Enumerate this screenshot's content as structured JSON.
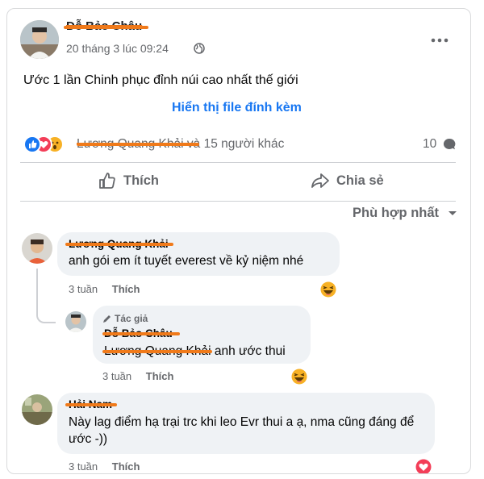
{
  "post": {
    "author_name": "Đỗ Bảo Châu",
    "timestamp": "20 tháng 3 lúc 09:24",
    "audience_icon": "globe-icon",
    "text": "Ước 1 lần Chinh phục đỉnh núi cao nhất thế giới",
    "attachment_link": "Hiển thị file đính kèm",
    "reactions": {
      "types": [
        "like",
        "love",
        "wow"
      ],
      "summary_name": "Lương Quang Khải",
      "summary_rest": "và 15 người khác",
      "comment_count": "10"
    },
    "actions": {
      "like_label": "Thích",
      "share_label": "Chia sẻ"
    },
    "sort_label": "Phù hợp nhất"
  },
  "comments": [
    {
      "name": "Lương Quang Khải",
      "text": "anh gói em ít tuyết everest về kỷ niệm nhé",
      "time": "3 tuần",
      "like_label": "Thích",
      "reaction": "haha"
    },
    {
      "author_badge": "Tác giả",
      "name": "Đỗ Bảo Châu",
      "mention": "Lương Quang Khải",
      "text": " anh ước thui",
      "time": "3 tuần",
      "like_label": "Thích",
      "reaction": "haha"
    },
    {
      "name": "Hải Nam",
      "text": "Này lag điểm hạ trại trc khi leo Evr thui a ạ, nma cũng đáng để ước -))",
      "time": "3 tuần",
      "like_label": "Thích",
      "reaction": "love"
    }
  ],
  "colors": {
    "accent": "#1877f2",
    "scribble": "#f07a1a",
    "love": "#f33e58",
    "haha": "#f7b125"
  }
}
